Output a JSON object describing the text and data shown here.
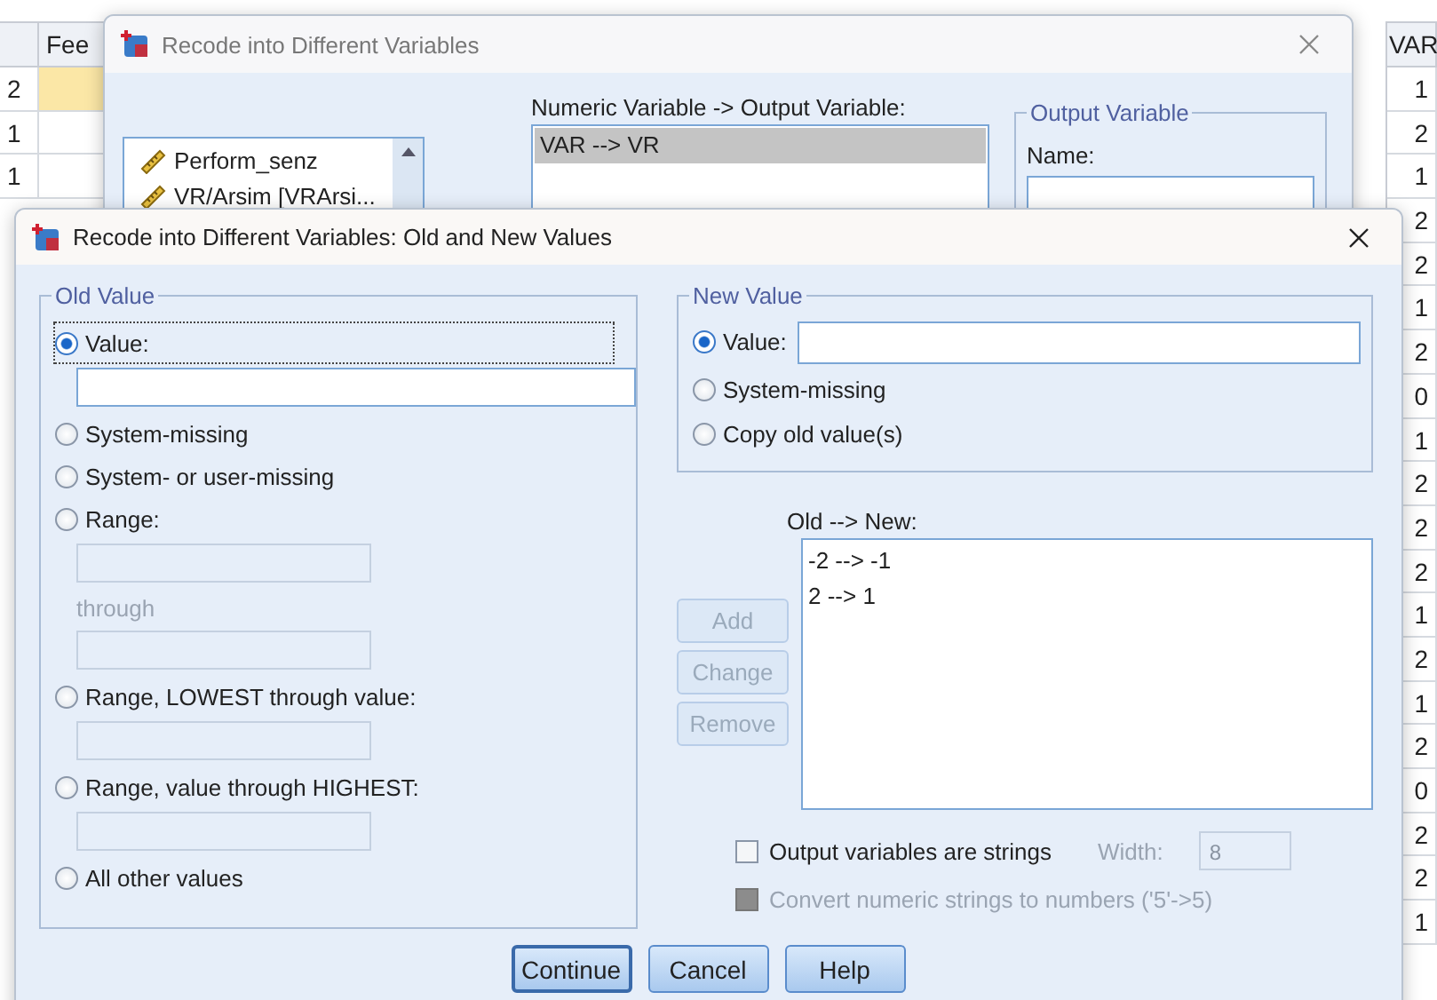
{
  "sheet": {
    "left_columns": [
      {
        "cells": [
          {
            "text": "2",
            "selected": false
          },
          {
            "text": "1",
            "selected": false
          },
          {
            "text": "1",
            "selected": false
          }
        ]
      },
      {
        "label": "Fee",
        "cells": [
          {
            "text": "",
            "selected": true
          },
          {
            "text": "",
            "selected": false
          },
          {
            "text": "",
            "selected": false
          }
        ]
      }
    ],
    "right_column": {
      "label": "VAR",
      "cells": [
        "1",
        "2",
        "1",
        "2",
        "2",
        "1",
        "2",
        "0",
        "1",
        "2",
        "2",
        "2",
        "1",
        "2",
        "1",
        "2",
        "0",
        "2",
        "2",
        "1"
      ]
    }
  },
  "back_dialog": {
    "title": "Recode into Different Variables",
    "source_list": [
      "Perform_senz",
      "VR/Arsim [VRArsi..."
    ],
    "mapping_label": "Numeric Variable -> Output Variable:",
    "mappings": [
      {
        "text": "VAR --> VR",
        "selected": true
      }
    ],
    "output_group": {
      "title": "Output Variable",
      "name_label": "Name:"
    }
  },
  "dialog": {
    "title": "Recode into Different Variables: Old and New Values",
    "old_value": {
      "title": "Old Value",
      "items": [
        {
          "kind": "radio",
          "label": "Value:",
          "selected": true,
          "focused": true
        },
        {
          "kind": "field",
          "disabled": false,
          "wide": true
        },
        {
          "kind": "radio",
          "label": "System-missing",
          "selected": false,
          "focused": false
        },
        {
          "kind": "radio",
          "label": "System- or user-missing",
          "selected": false,
          "focused": false
        },
        {
          "kind": "radio",
          "label": "Range:",
          "selected": false,
          "focused": false
        },
        {
          "kind": "field",
          "disabled": true,
          "wide": false
        },
        {
          "kind": "caption",
          "label": "through",
          "disabled": true
        },
        {
          "kind": "field",
          "disabled": true,
          "wide": false
        },
        {
          "kind": "radio",
          "label": "Range, LOWEST through value:",
          "selected": false,
          "focused": false
        },
        {
          "kind": "field",
          "disabled": true,
          "wide": false
        },
        {
          "kind": "radio",
          "label": "Range, value through HIGHEST:",
          "selected": false,
          "focused": false
        },
        {
          "kind": "field",
          "disabled": true,
          "wide": false
        },
        {
          "kind": "radio",
          "label": "All other values",
          "selected": false,
          "focused": false
        }
      ]
    },
    "new_value": {
      "title": "New Value",
      "items": [
        {
          "kind": "radio-field",
          "label": "Value:",
          "selected": true
        },
        {
          "kind": "radio",
          "label": "System-missing",
          "selected": false
        },
        {
          "kind": "radio",
          "label": "Copy old value(s)",
          "selected": false
        }
      ]
    },
    "list_label": "Old --> New:",
    "list_items": [
      "-2 --> -1",
      "2 --> 1"
    ],
    "list_buttons": [
      {
        "label": "Add",
        "disabled": true
      },
      {
        "label": "Change",
        "disabled": true
      },
      {
        "label": "Remove",
        "disabled": true
      }
    ],
    "options": [
      {
        "label": "Output variables are strings",
        "checked": false,
        "disabled": false
      },
      {
        "label": "Convert numeric strings to numbers ('5'->5)",
        "checked": false,
        "disabled": true
      }
    ],
    "width": {
      "label": "Width:",
      "value": "8",
      "disabled": true
    },
    "buttons": [
      {
        "label": "Continue",
        "default": true
      },
      {
        "label": "Cancel",
        "default": false
      },
      {
        "label": "Help",
        "default": false
      }
    ]
  }
}
